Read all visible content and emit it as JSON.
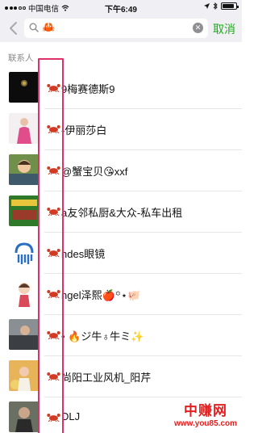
{
  "status_bar": {
    "carrier": "中国电信",
    "time": "下午6:49"
  },
  "header": {
    "search_value": "🦀",
    "cancel_label": "取消"
  },
  "section": {
    "label": "联系人"
  },
  "contacts": [
    {
      "name": "9梅赛德斯9",
      "avatar": "avatar-dark-flower"
    },
    {
      "name": "-伊丽莎白",
      "avatar": "avatar-woman-pink"
    },
    {
      "name": "@蟹宝贝😘xxf",
      "avatar": "avatar-child-photo"
    },
    {
      "name": "a友邻私厨&大众-私车出租",
      "avatar": "avatar-car-ad"
    },
    {
      "name": "ndes眼镜",
      "avatar": "avatar-blue-logo"
    },
    {
      "name": "ngel泽熙🍎꙳⋆🐖",
      "avatar": "avatar-cartoon-girl"
    },
    {
      "name": "• 🔥ジ牛♁牛ミ✨",
      "avatar": "avatar-man-car"
    },
    {
      "name": "尚阳工业风机_阳芹",
      "avatar": "avatar-woman-flowers"
    },
    {
      "name": "DLJ",
      "avatar": "avatar-man-dark"
    }
  ],
  "watermark": {
    "title": "中赚网",
    "url": "www.you85.com"
  },
  "colors": {
    "accent_green": "#1aad19",
    "highlight_pink": "#e0306a",
    "watermark_red": "#e02020",
    "header_bg": "#efeff4"
  }
}
